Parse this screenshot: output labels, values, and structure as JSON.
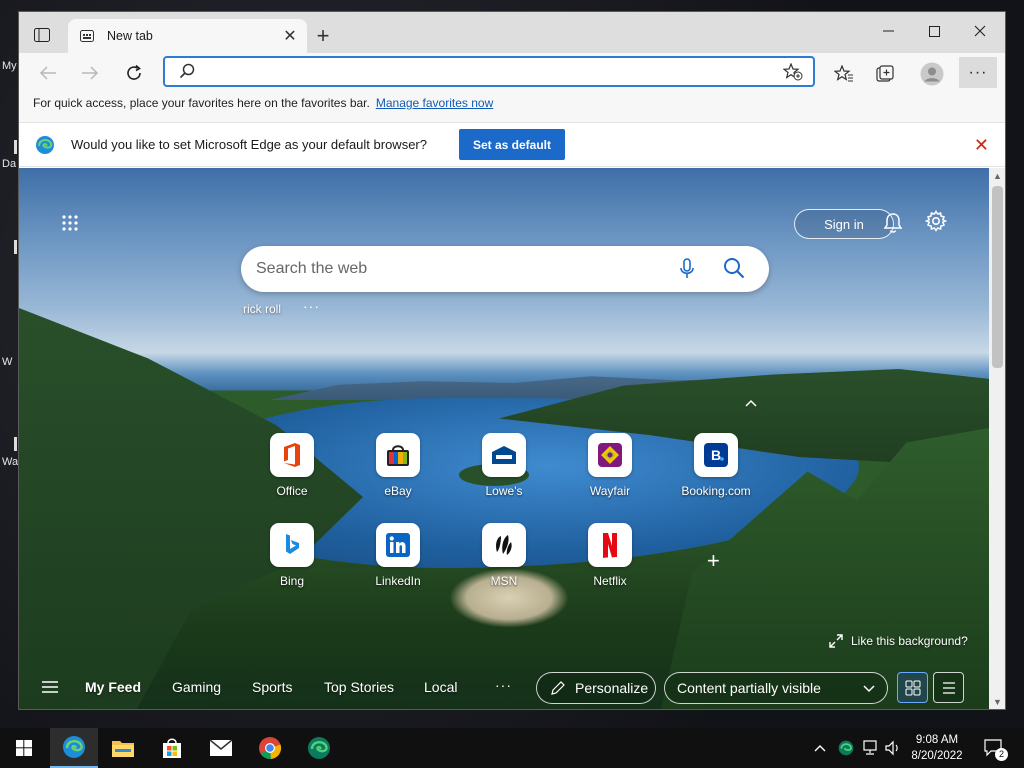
{
  "desktop": {
    "labels": [
      "My",
      "Da",
      "W",
      "Wa"
    ]
  },
  "browser": {
    "tab": {
      "title": "New tab"
    },
    "address": {
      "value": "",
      "placeholder": ""
    },
    "favorites_bar": {
      "text": "For quick access, place your favorites here on the favorites bar.",
      "link": "Manage favorites now"
    },
    "infobar": {
      "text": "Would you like to set Microsoft Edge as your default browser?",
      "button": "Set as default"
    }
  },
  "ntp": {
    "signin": "Sign in",
    "search_placeholder": "Search the web",
    "recent_search": "rick roll",
    "tiles": [
      {
        "label": "Office",
        "icon": "office-icon"
      },
      {
        "label": "eBay",
        "icon": "ebay-icon"
      },
      {
        "label": "Lowe's",
        "icon": "lowes-icon"
      },
      {
        "label": "Wayfair",
        "icon": "wayfair-icon"
      },
      {
        "label": "Booking.com",
        "icon": "booking-icon"
      },
      {
        "label": "Bing",
        "icon": "bing-icon"
      },
      {
        "label": "LinkedIn",
        "icon": "linkedin-icon"
      },
      {
        "label": "MSN",
        "icon": "msn-icon"
      },
      {
        "label": "Netflix",
        "icon": "netflix-icon"
      }
    ],
    "like_background": "Like this background?",
    "feed_tabs": [
      "My Feed",
      "Gaming",
      "Sports",
      "Top Stories",
      "Local"
    ],
    "personalize": "Personalize",
    "content_visibility": "Content partially visible"
  },
  "taskbar": {
    "time": "9:08 AM",
    "date": "8/20/2022",
    "notification_count": "2",
    "apps": [
      "edge-icon",
      "file-explorer-icon",
      "store-icon",
      "mail-icon",
      "chrome-icon",
      "edge-dev-icon"
    ]
  },
  "colors": {
    "accent": "#1b6ac9",
    "address_border": "#2e7bd6",
    "close_red": "#c42b1c"
  }
}
